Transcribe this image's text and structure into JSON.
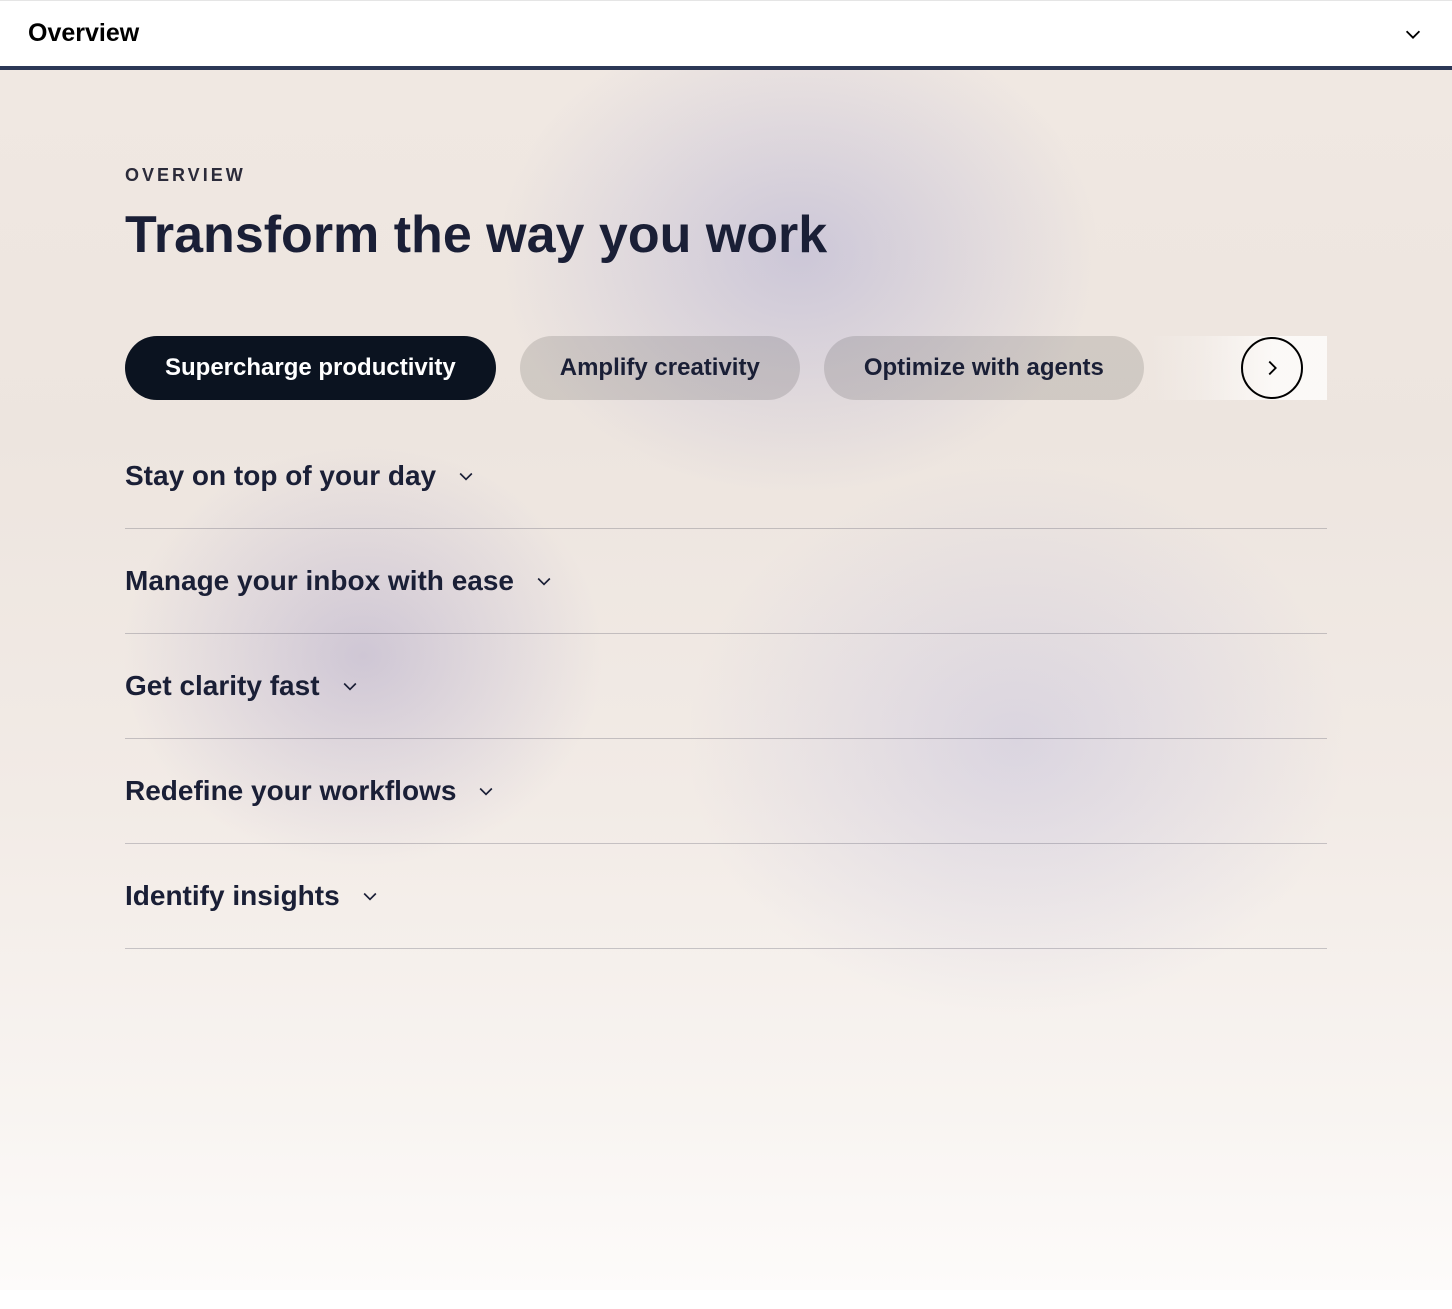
{
  "topBar": {
    "title": "Overview"
  },
  "hero": {
    "eyebrow": "OVERVIEW",
    "title": "Transform the way you work"
  },
  "tabs": [
    {
      "label": "Supercharge productivity",
      "active": true
    },
    {
      "label": "Amplify creativity",
      "active": false
    },
    {
      "label": "Optimize with agents",
      "active": false
    }
  ],
  "accordion": [
    {
      "title": "Stay on top of your day"
    },
    {
      "title": "Manage your inbox with ease"
    },
    {
      "title": "Get clarity fast"
    },
    {
      "title": "Redefine your workflows"
    },
    {
      "title": "Identify insights"
    }
  ]
}
